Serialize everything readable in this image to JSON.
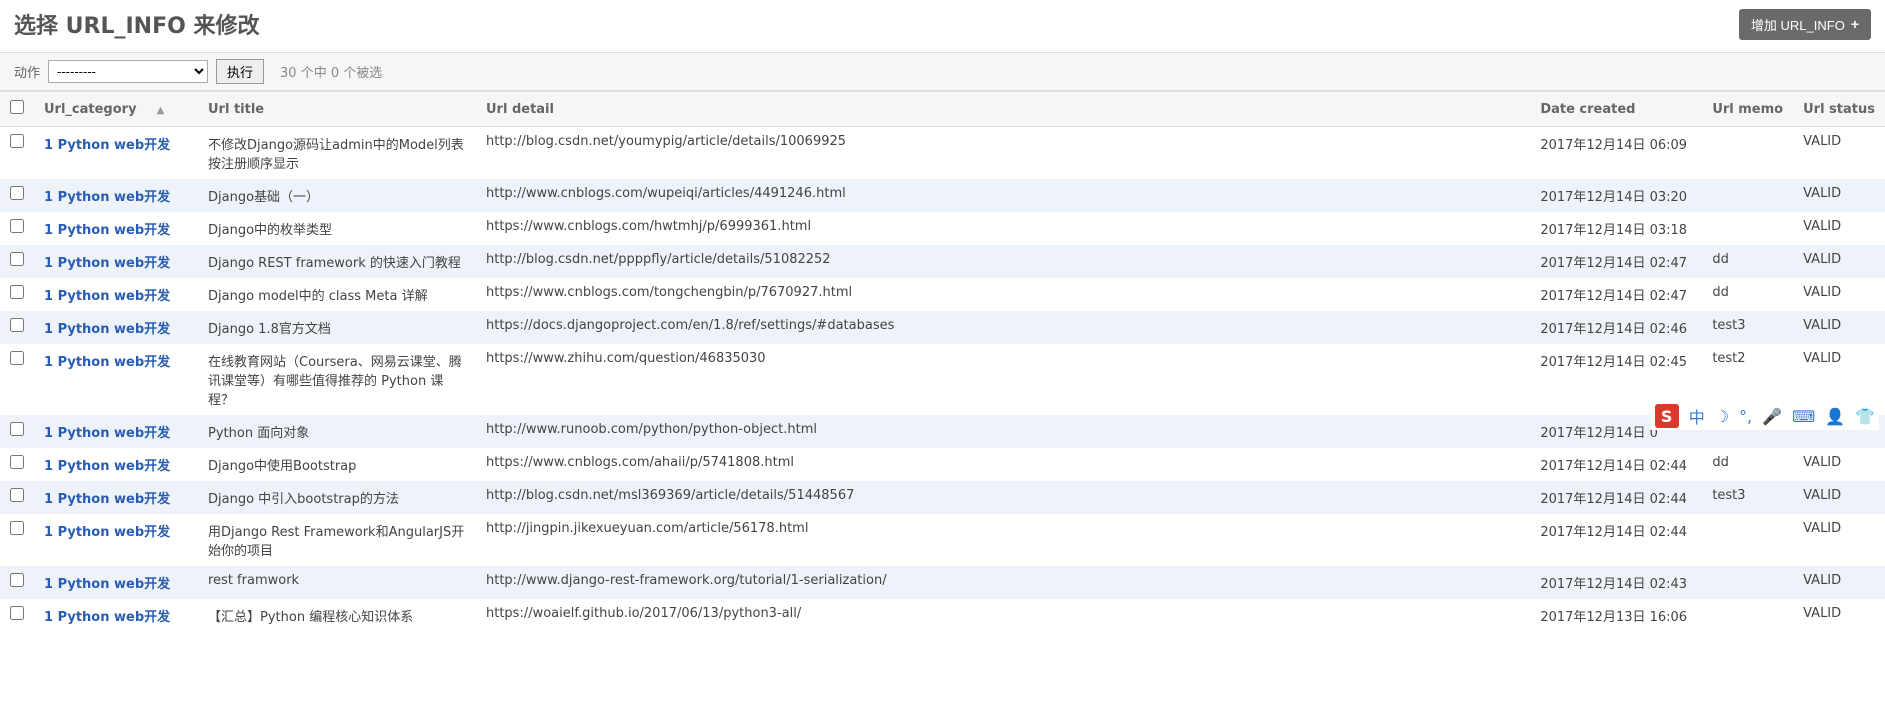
{
  "header": {
    "title": "选择 URL_INFO 来修改",
    "add_button": "增加 URL_INFO"
  },
  "actions": {
    "label": "动作",
    "select_placeholder": "---------",
    "go": "执行",
    "count": "30 个中 0 个被选"
  },
  "columns": {
    "category": "Url_category",
    "title": "Url title",
    "detail": "Url detail",
    "date": "Date created",
    "memo": "Url memo",
    "status": "Url status"
  },
  "rows": [
    {
      "category": "1 Python web开发",
      "title": "不修改Django源码让admin中的Model列表按注册顺序显示",
      "detail": "http://blog.csdn.net/youmypig/article/details/10069925",
      "date": "2017年12月14日 06:09",
      "memo": "",
      "status": "VALID"
    },
    {
      "category": "1 Python web开发",
      "title": "Django基础（一）",
      "detail": "http://www.cnblogs.com/wupeiqi/articles/4491246.html",
      "date": "2017年12月14日 03:20",
      "memo": "",
      "status": "VALID"
    },
    {
      "category": "1 Python web开发",
      "title": "Django中的枚举类型",
      "detail": "https://www.cnblogs.com/hwtmhj/p/6999361.html",
      "date": "2017年12月14日 03:18",
      "memo": "",
      "status": "VALID"
    },
    {
      "category": "1 Python web开发",
      "title": "Django REST framework 的快速入门教程",
      "detail": "http://blog.csdn.net/ppppfly/article/details/51082252",
      "date": "2017年12月14日 02:47",
      "memo": "dd",
      "status": "VALID"
    },
    {
      "category": "1 Python web开发",
      "title": "Django model中的 class Meta 详解",
      "detail": "https://www.cnblogs.com/tongchengbin/p/7670927.html",
      "date": "2017年12月14日 02:47",
      "memo": "dd",
      "status": "VALID"
    },
    {
      "category": "1 Python web开发",
      "title": "Django 1.8官方文档",
      "detail": "https://docs.djangoproject.com/en/1.8/ref/settings/#databases",
      "date": "2017年12月14日 02:46",
      "memo": "test3",
      "status": "VALID"
    },
    {
      "category": "1 Python web开发",
      "title": "在线教育网站（Coursera、网易云课堂、腾讯课堂等）有哪些值得推荐的 Python 课程？",
      "detail": "https://www.zhihu.com/question/46835030",
      "date": "2017年12月14日 02:45",
      "memo": "test2",
      "status": "VALID"
    },
    {
      "category": "1 Python web开发",
      "title": "Python 面向对象",
      "detail": "http://www.runoob.com/python/python-object.html",
      "date": "2017年12月14日 0",
      "memo": "",
      "status": ""
    },
    {
      "category": "1 Python web开发",
      "title": "Django中使用Bootstrap",
      "detail": "https://www.cnblogs.com/ahaii/p/5741808.html",
      "date": "2017年12月14日 02:44",
      "memo": "dd",
      "status": "VALID"
    },
    {
      "category": "1 Python web开发",
      "title": "Django 中引入bootstrap的方法",
      "detail": "http://blog.csdn.net/msl369369/article/details/51448567",
      "date": "2017年12月14日 02:44",
      "memo": "test3",
      "status": "VALID"
    },
    {
      "category": "1 Python web开发",
      "title": "用Django Rest Framework和AngularJS开始你的项目",
      "detail": "http://jingpin.jikexueyuan.com/article/56178.html",
      "date": "2017年12月14日 02:44",
      "memo": "",
      "status": "VALID"
    },
    {
      "category": "1 Python web开发",
      "title": "rest framwork",
      "detail": "http://www.django-rest-framework.org/tutorial/1-serialization/",
      "date": "2017年12月14日 02:43",
      "memo": "",
      "status": "VALID"
    },
    {
      "category": "1 Python web开发",
      "title": "【汇总】Python 编程核心知识体系",
      "detail": "https://woaielf.github.io/2017/06/13/python3-all/",
      "date": "2017年12月13日 16:06",
      "memo": "",
      "status": "VALID"
    }
  ],
  "ime": {
    "cn": "中"
  }
}
